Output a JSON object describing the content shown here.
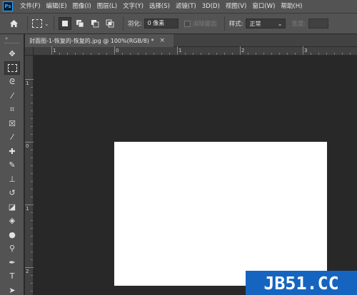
{
  "app": {
    "logo_text": "Ps"
  },
  "menu": [
    "文件(F)",
    "编辑(E)",
    "图像(I)",
    "图层(L)",
    "文字(Y)",
    "选择(S)",
    "滤镜(T)",
    "3D(D)",
    "视图(V)",
    "窗口(W)",
    "帮助(H)"
  ],
  "options": {
    "feather_label": "羽化:",
    "feather_value": "0 像素",
    "antialias_label": "消除锯齿",
    "style_label": "样式:",
    "style_value": "正常",
    "width_label": "宽度:"
  },
  "toolbar": {
    "collapse_glyph": "»",
    "tools": [
      {
        "name": "move-tool",
        "icon": "move-icon",
        "glyph": "✥"
      },
      {
        "name": "rect-marquee-tool",
        "icon": "rect-marquee-icon",
        "glyph": "",
        "active": true
      },
      {
        "name": "lasso-tool",
        "icon": "lasso-icon",
        "glyph": "ᘓ"
      },
      {
        "name": "magic-wand-tool",
        "icon": "magic-wand-icon",
        "glyph": "⁄"
      },
      {
        "name": "crop-tool",
        "icon": "crop-icon",
        "glyph": "⌗"
      },
      {
        "name": "frame-tool",
        "icon": "frame-icon",
        "glyph": "☒"
      },
      {
        "name": "eyedropper-tool",
        "icon": "eyedropper-icon",
        "glyph": "⁄"
      },
      {
        "name": "healing-brush-tool",
        "icon": "healing-brush-icon",
        "glyph": "✚"
      },
      {
        "name": "brush-tool",
        "icon": "brush-icon",
        "glyph": "✎"
      },
      {
        "name": "clone-stamp-tool",
        "icon": "clone-stamp-icon",
        "glyph": "⊥"
      },
      {
        "name": "history-brush-tool",
        "icon": "history-brush-icon",
        "glyph": "↺"
      },
      {
        "name": "eraser-tool",
        "icon": "eraser-icon",
        "glyph": "◪"
      },
      {
        "name": "paint-bucket-tool",
        "icon": "paint-bucket-icon",
        "glyph": "◈"
      },
      {
        "name": "blur-tool",
        "icon": "blur-icon",
        "glyph": "●"
      },
      {
        "name": "dodge-tool",
        "icon": "dodge-icon",
        "glyph": "⚲"
      },
      {
        "name": "pen-tool",
        "icon": "pen-icon",
        "glyph": "✒"
      },
      {
        "name": "type-tool",
        "icon": "type-icon",
        "glyph": "T"
      },
      {
        "name": "path-selection-tool",
        "icon": "path-selection-icon",
        "glyph": "➤"
      }
    ]
  },
  "document": {
    "tab_title": "封面图-1-恢复的-恢复的.jpg @ 100%(RGB/8) *",
    "close_glyph": "×"
  },
  "rulers": {
    "horizontal_labels": [
      "1",
      "0",
      "1",
      "2",
      "3"
    ],
    "vertical_labels": [
      "1",
      "0",
      "1",
      "2"
    ]
  },
  "watermark": {
    "text": "JB51.CC"
  },
  "colors": {
    "panel": "#535353",
    "workspace": "#282828",
    "canvas": "#ffffff",
    "watermark_bg": "#1565c0"
  }
}
